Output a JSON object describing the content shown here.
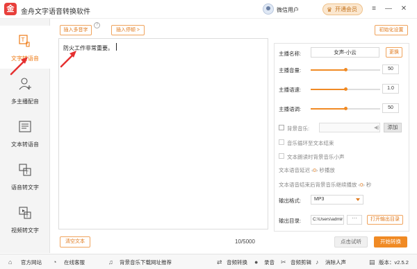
{
  "window": {
    "title": "金舟文字语音转换软件",
    "logo_icon": "app-logo-icon",
    "user_name": "微信用户",
    "vip_label": "开通会员",
    "controls": [
      "≡",
      "—",
      "✕"
    ]
  },
  "sidebar": {
    "items": [
      {
        "label": "文字转语音",
        "icon": "text-to-speech-icon",
        "active": true
      },
      {
        "label": "多主播配音",
        "icon": "multi-speaker-icon",
        "active": false
      },
      {
        "label": "文本转语音",
        "icon": "document-speech-icon",
        "active": false
      },
      {
        "label": "语音转文字",
        "icon": "speech-to-text-icon",
        "active": false
      },
      {
        "label": "视频转文字",
        "icon": "video-to-text-icon",
        "active": false
      }
    ]
  },
  "toolbar": {
    "insert_pause": "插入多音字",
    "insert_stop": "插入停顿 >",
    "init_settings": "初始化设置"
  },
  "editor": {
    "text": "防火工作非常重要。"
  },
  "footer_actions": {
    "clear_text": "清空文本",
    "char_count": "10/5000",
    "preview": "点击试听",
    "start": "开始转换"
  },
  "settings": {
    "anchor_name_label": "主播名称:",
    "anchor_name": "女声-小云",
    "change_label": "更换",
    "volume_label": "主播音量:",
    "volume_value": "50",
    "volume_level": 0.5,
    "speed_label": "主播语速:",
    "speed_value": "1.0",
    "speed_level": 0.5,
    "pitch_label": "主播语调:",
    "pitch_value": "50",
    "pitch_level": 0.5,
    "bgm_label": "背景音乐:",
    "add_label": "添加",
    "loop_label": "音乐循环至文本结束",
    "lower_label": "文本朗读时背景音乐小声",
    "delay_prefix": "文本语音延迟",
    "delay_value": "0",
    "delay_suffix": "秒播放",
    "after_prefix": "文本语音结束后背景音乐继续播放",
    "after_value": "0",
    "after_suffix": "秒",
    "format_label": "输出格式:",
    "format_value": "MP3",
    "dir_label": "输出目录:",
    "dir_value": "C:\\Users\\admir",
    "dir_more": "···",
    "open_dir_label": "打开输出目录"
  },
  "bottombar": {
    "items": [
      {
        "label": "官方网站",
        "icon": "home-icon"
      },
      {
        "label": "在线客服",
        "icon": "chat-icon"
      },
      {
        "label": "背景音乐下载网址推荐",
        "icon": "music-icon"
      },
      {
        "label": "音频转换",
        "icon": "audio-convert-icon"
      },
      {
        "label": "录音",
        "icon": "record-icon"
      },
      {
        "label": "音频剪辑",
        "icon": "audio-edit-icon"
      },
      {
        "label": "消除人声",
        "icon": "remove-vocal-icon"
      }
    ],
    "version": "版本：v2.5.2"
  },
  "colors": {
    "accent": "#f08a24",
    "annotation_arrow": "#e53030"
  }
}
